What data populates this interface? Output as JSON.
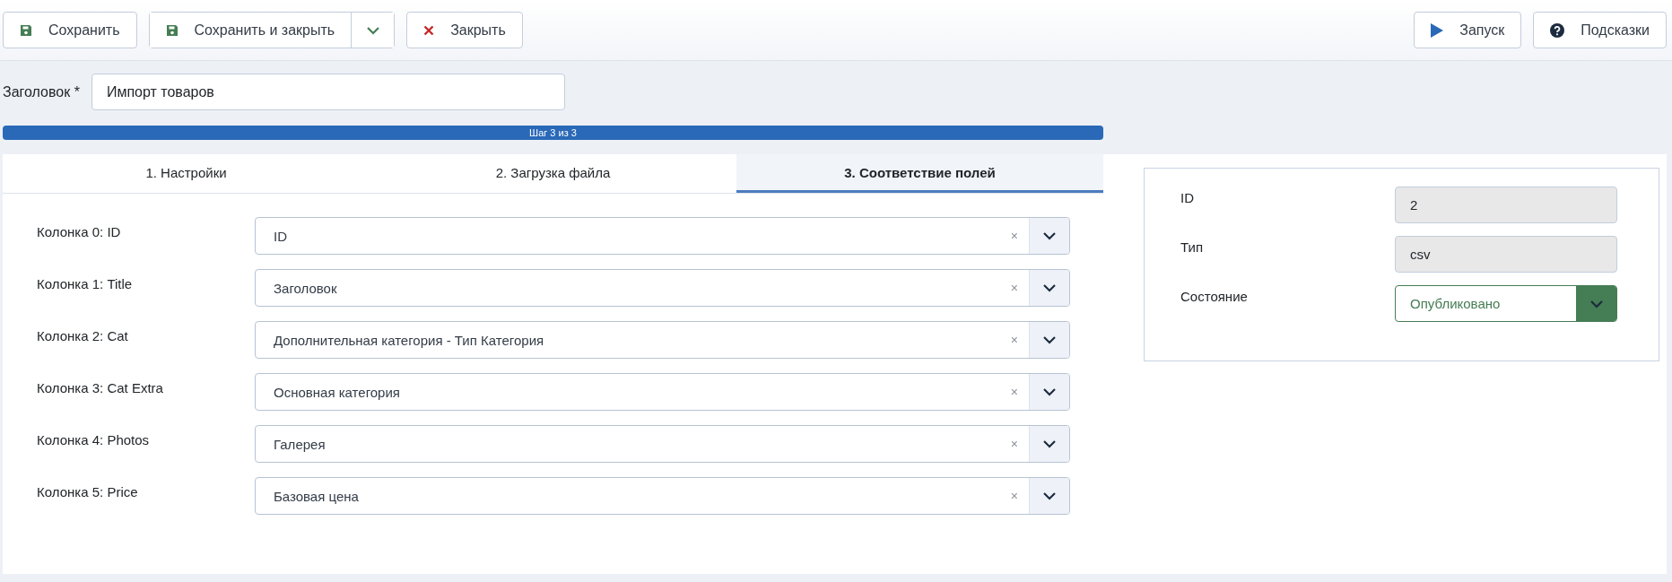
{
  "toolbar": {
    "left": [
      {
        "kind": "save",
        "label": "Сохранить"
      },
      {
        "kind": "save-split",
        "label": "Сохранить и закрыть"
      },
      {
        "kind": "close",
        "label": "Закрыть"
      }
    ],
    "right": [
      {
        "kind": "play",
        "label": "Запуск"
      },
      {
        "kind": "help",
        "label": "Подсказки"
      }
    ]
  },
  "title_field": {
    "label": "Заголовок *",
    "value": "Импорт товаров"
  },
  "progress": {
    "text": "Шаг 3 из 3",
    "level": 1
  },
  "tabs": [
    {
      "label": "1. Настройки",
      "selected": false
    },
    {
      "label": "2. Загрузка файла",
      "selected": false
    },
    {
      "label": "3. Соответствие полей",
      "selected": true
    }
  ],
  "mappings": [
    {
      "label": "Колонка 0: ID",
      "value": "ID",
      "clear": "×"
    },
    {
      "label": "Колонка 1: Title",
      "value": "Заголовок",
      "clear": "×"
    },
    {
      "label": "Колонка 2: Cat",
      "value": "Дополнительная категория - Тип Категория",
      "clear": "×"
    },
    {
      "label": "Колонка 3: Cat Extra",
      "value": "Основная категория",
      "clear": "×"
    },
    {
      "label": "Колонка 4: Photos",
      "value": "Галерея",
      "clear": "×"
    },
    {
      "label": "Колонка 5: Price",
      "value": "Базовая цена",
      "clear": "×"
    }
  ],
  "details": [
    {
      "kind": "readonly",
      "label": "ID",
      "value": "2"
    },
    {
      "kind": "readonly",
      "label": "Тип",
      "value": "csv"
    },
    {
      "kind": "status",
      "label": "Состояние",
      "value": "Опубликовано"
    }
  ]
}
